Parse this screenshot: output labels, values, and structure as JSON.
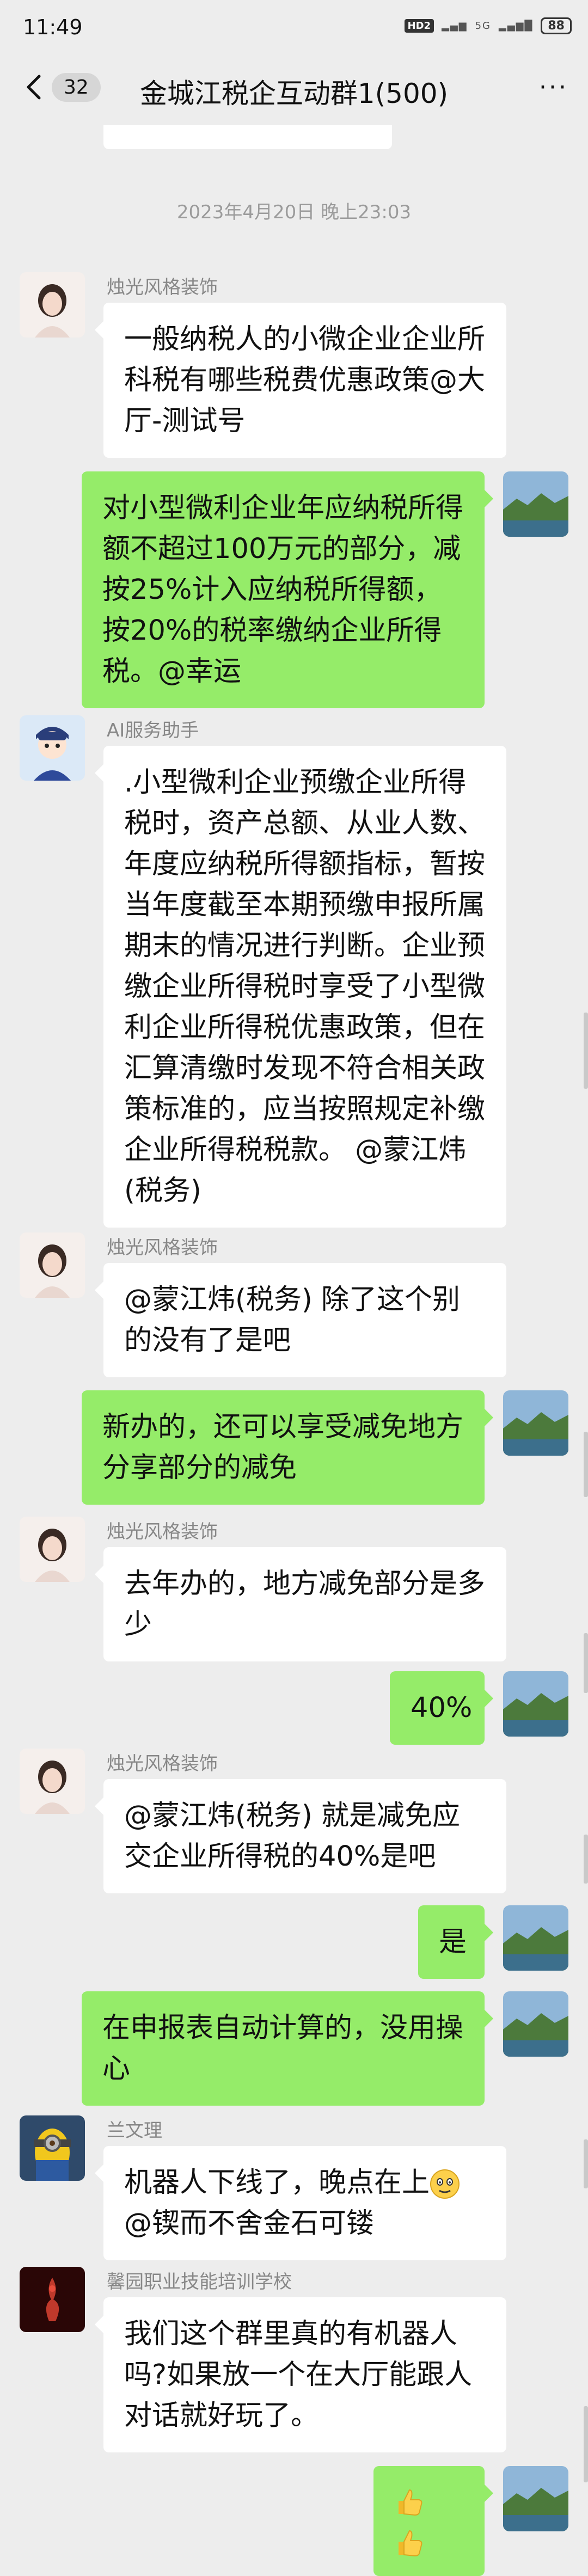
{
  "status_bar": {
    "time": "11:49",
    "hd": "HD2",
    "network": "5G",
    "battery": "88"
  },
  "header": {
    "back_count": "32",
    "title": "金城江税企互动群1(500)"
  },
  "timestamp": "2023年4月20日 晚上23:03",
  "messages": [
    {
      "side": "left",
      "nick": "烛光风格装饰",
      "text": "一般纳税人的小微企业企业所科税有哪些税费优惠政策@大厅-测试号"
    },
    {
      "side": "right",
      "text": "对小型微利企业年应纳税所得额不超过100万元的部分，减按25%计入应纳税所得额，按20%的税率缴纳企业所得税。@幸运"
    },
    {
      "side": "left",
      "nick": "AI服务助手",
      "text": ".小型微利企业预缴企业所得税时，资产总额、从业人数、年度应纳税所得额指标，暂按当年度截至本期预缴申报所属期末的情况进行判断。企业预缴企业所得税时享受了小型微利企业所得税优惠政策，但在汇算清缴时发现不符合相关政策标准的，应当按照规定补缴企业所得税税款。 @蒙江炜(税务)"
    },
    {
      "side": "left",
      "nick": "烛光风格装饰",
      "text": "@蒙江炜(税务) 除了这个别的没有了是吧"
    },
    {
      "side": "right",
      "text": "新办的，还可以享受减免地方分享部分的减免"
    },
    {
      "side": "left",
      "nick": "烛光风格装饰",
      "text": "去年办的，地方减免部分是多少"
    },
    {
      "side": "right",
      "text": "40%"
    },
    {
      "side": "left",
      "nick": "烛光风格装饰",
      "text": "@蒙江炜(税务) 就是减免应交企业所得税的40%是吧"
    },
    {
      "side": "right",
      "text": "是"
    },
    {
      "side": "right",
      "text": "在申报表自动计算的，没用操心"
    },
    {
      "side": "left",
      "nick": "兰文理",
      "text_before": "机器人下线了，晚点在上",
      "emoji": "awkward-smile-emoji",
      "text_after": "@锲而不舍金石可镂"
    },
    {
      "side": "left",
      "nick": "馨园职业技能培训学校",
      "text": "我们这个群里真的有机器人吗?如果放一个在大厅能跟人对话就好玩了。"
    },
    {
      "side": "right",
      "emoji": "thumbs-up-emoji x2"
    }
  ]
}
